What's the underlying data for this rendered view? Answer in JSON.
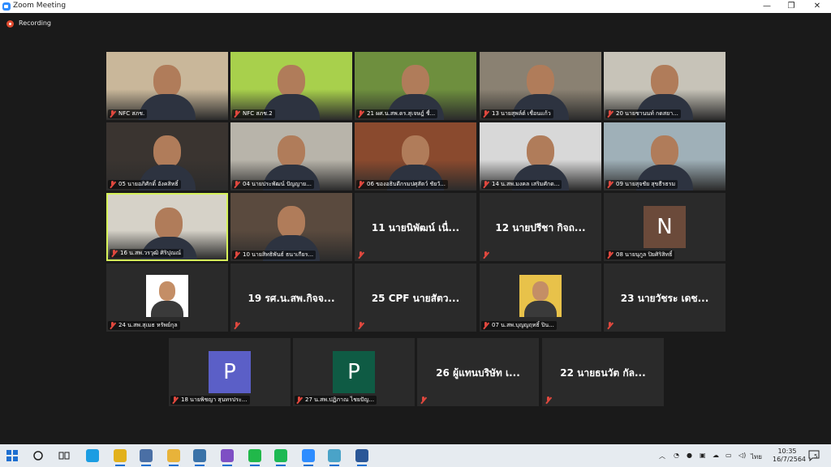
{
  "window": {
    "title": "Zoom Meeting",
    "minimize": "—",
    "maximize": "❐",
    "close": "✕"
  },
  "recording": {
    "label": "Recording",
    "color": "#e04a2f"
  },
  "participants": [
    {
      "name": "NFC สภช.",
      "type": "video",
      "bg": "#c9b79a"
    },
    {
      "name": "NFC สภช.2",
      "type": "video",
      "bg": "#a8d04c"
    },
    {
      "name": "21 ผศ.น.สพ.ดร.สุเจษฎ์ ชื่...",
      "type": "video",
      "bg": "#6e8f3e"
    },
    {
      "name": "13 นายสุพล์ต์ เชื่อนแก้ว",
      "type": "video",
      "bg": "#8a8172"
    },
    {
      "name": "20 นายชานนท์ กดสยา...",
      "type": "video",
      "bg": "#c7c3b8"
    },
    {
      "name": "05 นายอภิศักดิ์ อังคสิทธิ์",
      "type": "video",
      "bg": "#3a3430"
    },
    {
      "name": "04 นายประพัฒน์ ปัญญาย...",
      "type": "video",
      "bg": "#b8b4aa"
    },
    {
      "name": "06 ของอธิบดีกรมปศุสัตว์ ชัยวั...",
      "type": "video",
      "bg": "#8a4a2e"
    },
    {
      "name": "14 น.สพ.มงคล เสริมศักด...",
      "type": "video",
      "bg": "#d8d8d8"
    },
    {
      "name": "09 นายสุจชัย สุขธีรธรม",
      "type": "video",
      "bg": "#9fb0b8"
    },
    {
      "name": "16 น.สพ.วรวุฒิ ศิริปุณณ์",
      "type": "video",
      "bg": "#d6d2c8",
      "active": true
    },
    {
      "name": "10 นายสิทธิพันธ์ ธนาเกียร...",
      "type": "video",
      "bg": "#5a4a3e"
    },
    {
      "name": "11 นายนิพัฒน์ เนื่...",
      "type": "name"
    },
    {
      "name": "12 นายปรีชา กิจถ...",
      "type": "name"
    },
    {
      "name": "08 นายนุกูล ปิยศิริสิทธิ์",
      "type": "avatar",
      "letter": "N",
      "bg": "#6b4a3a"
    },
    {
      "name": "24 น.สพ.สุเมธ หรัพย์กุล",
      "type": "photo",
      "bg": "#ffffff"
    },
    {
      "name": "19 รศ.น.สพ.กิจจ...",
      "type": "name"
    },
    {
      "name": "25 CPF นายสัตว...",
      "type": "name"
    },
    {
      "name": "07 น.สพ.บุญญฤทธิ์ ปิน...",
      "type": "photo",
      "bg": "#e8c24a"
    },
    {
      "name": "23 นายวัชระ เดช...",
      "type": "name"
    },
    {
      "name": "18 นายพิชญา สุนทรประ...",
      "type": "avatar",
      "letter": "P",
      "bg": "#5b5fc7"
    },
    {
      "name": "27 น.สพ.ปฏิภาณ ไชยปัญ...",
      "type": "avatar",
      "letter": "P",
      "bg": "#0f5b44"
    },
    {
      "name": "26 ผู้แทนบริษัท เ...",
      "type": "name"
    },
    {
      "name": "22 นายธนวัต กัล...",
      "type": "name"
    }
  ],
  "taskbar": {
    "apps": [
      "windows-start",
      "search",
      "task-view",
      "edge",
      "chrome",
      "network-app",
      "file-explorer",
      "python",
      "visual-studio",
      "line",
      "spotify",
      "zoom",
      "notes",
      "word"
    ],
    "language": "ไทย",
    "time": "10:35",
    "date": "16/7/2564",
    "notifications": "5"
  }
}
